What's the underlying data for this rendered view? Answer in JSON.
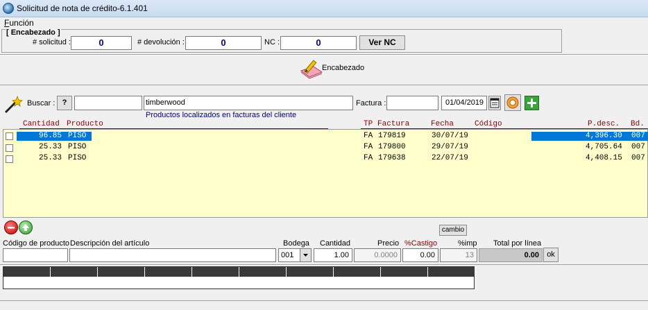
{
  "window": {
    "title": "Solicitud de nota de crédito-6.1.401"
  },
  "menu": {
    "funcion": "Función",
    "funcion_first": "F",
    "funcion_rest": "unción"
  },
  "encabezado": {
    "group_label": "[ Encabezado ]",
    "solicitud_label": "# solicitud :",
    "solicitud_value": "0",
    "devolucion_label": "# devolución :",
    "devolucion_value": "0",
    "nc_label": "NC :",
    "nc_value": "0",
    "ver_nc_button": "Ver NC"
  },
  "toolbar": {
    "encabezado_button": "Encabezado"
  },
  "search": {
    "buscar_label": "Buscar :",
    "help_button": "?",
    "code_value": "",
    "query_value": "timberwood",
    "hint": "Productos localizados en facturas del cliente",
    "factura_label": "Factura :",
    "factura_value": "",
    "date_value": "01/04/2019"
  },
  "results": {
    "headers": {
      "cantidad": "Cantidad",
      "producto": "Producto",
      "tp": "TP",
      "factura": "Factura",
      "fecha": "Fecha",
      "codigo": "Código",
      "pdesc": "P.desc.",
      "bd": "Bd."
    },
    "rows": [
      {
        "cantidad": "96.85",
        "producto": "PISO",
        "tp": "FA",
        "factura": "179819",
        "fecha": "30/07/19",
        "codigo": "",
        "pdesc": "4,396.30",
        "bd": "007",
        "selected": true
      },
      {
        "cantidad": "25.33",
        "producto": "PISO",
        "tp": "FA",
        "factura": "179800",
        "fecha": "29/07/19",
        "codigo": "",
        "pdesc": "4,705.64",
        "bd": "007",
        "selected": false
      },
      {
        "cantidad": "25.33",
        "producto": "PISO",
        "tp": "FA",
        "factura": "179638",
        "fecha": "22/07/19",
        "codigo": "",
        "pdesc": "4,408.15",
        "bd": "007",
        "selected": false
      }
    ]
  },
  "entry": {
    "cambio_button": "cambio",
    "codigo_label": "Código de producto",
    "descripcion_label": "Descripción del artículo",
    "bodega_label": "Bodega",
    "bodega_value": "001",
    "cantidad_label": "Cantidad",
    "cantidad_value": "1.00",
    "precio_label": "Precio",
    "precio_value": "0.0000",
    "castigo_label": "%Castigo",
    "castigo_value": "0.00",
    "imp_label": "%imp",
    "imp_value": "13",
    "total_label": "Total por línea",
    "total_value": "0.00",
    "ok_button": "ok"
  },
  "colors": {
    "selection": "#0078d7",
    "grid_bg": "#ffffcc",
    "header_red": "#8b0000",
    "number_blue": "#00008b"
  }
}
